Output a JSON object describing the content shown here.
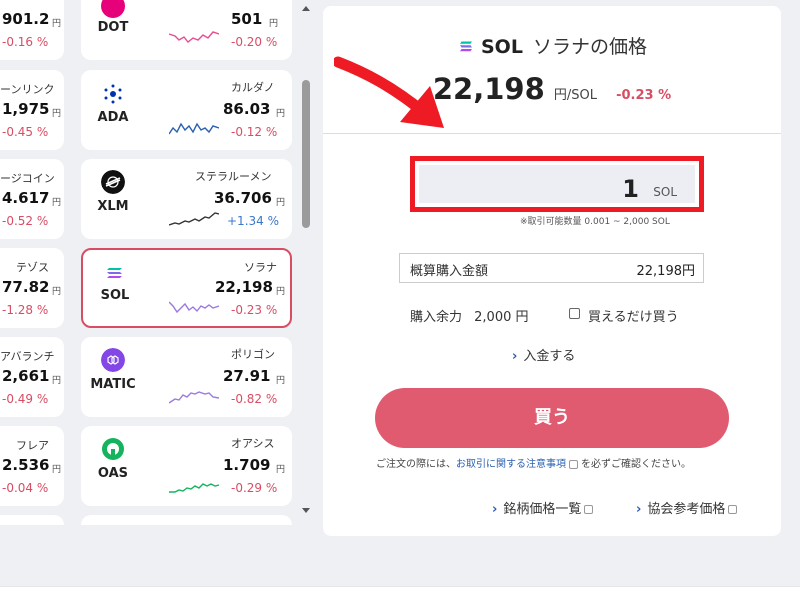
{
  "coins_col1": [
    {
      "ticker": "",
      "name": "",
      "price": "901.2",
      "yen": "円",
      "change": "-0.16 %",
      "dir": "neg"
    },
    {
      "ticker": "",
      "name": "ーンリンク",
      "price": "1,975",
      "yen": "円",
      "change": "-0.45 %",
      "dir": "neg"
    },
    {
      "ticker": "",
      "name": "ージコイン",
      "price": "4.617",
      "yen": "円",
      "change": "-0.52 %",
      "dir": "neg"
    },
    {
      "ticker": "",
      "name": "テゾス",
      "price": "77.82",
      "yen": "円",
      "change": "-1.28 %",
      "dir": "neg"
    },
    {
      "ticker": "",
      "name": "アバランチ",
      "price": "2,661",
      "yen": "円",
      "change": "-0.49 %",
      "dir": "neg"
    },
    {
      "ticker": "",
      "name": "フレア",
      "price": "2.536",
      "yen": "円",
      "change": "-0.04 %",
      "dir": "neg"
    }
  ],
  "coins_col2": [
    {
      "ticker": "DOT",
      "name": "",
      "price": "501",
      "yen": "円",
      "change": "-0.20 %",
      "dir": "neg",
      "icon": "polkadot-icon",
      "color": "#e6007a"
    },
    {
      "ticker": "ADA",
      "name": "カルダノ",
      "price": "86.03",
      "yen": "円",
      "change": "-0.12 %",
      "dir": "neg",
      "icon": "cardano-icon",
      "color": "#0033ad"
    },
    {
      "ticker": "XLM",
      "name": "ステラルーメン",
      "price": "36.706",
      "yen": "円",
      "change": "+1.34 %",
      "dir": "pos",
      "icon": "stellar-icon",
      "color": "#111111"
    },
    {
      "ticker": "SOL",
      "name": "ソラナ",
      "price": "22,198",
      "yen": "円",
      "change": "-0.23 %",
      "dir": "neg",
      "icon": "solana-icon",
      "color": "#9945ff"
    },
    {
      "ticker": "MATIC",
      "name": "ポリゴン",
      "price": "27.91",
      "yen": "円",
      "change": "-0.82 %",
      "dir": "neg",
      "icon": "polygon-icon",
      "color": "#8247e5"
    },
    {
      "ticker": "OAS",
      "name": "オアシス",
      "price": "1.709",
      "yen": "円",
      "change": "-0.29 %",
      "dir": "neg",
      "icon": "oasys-icon",
      "color": "#16b35e"
    }
  ],
  "detail": {
    "symbol": "SOL",
    "title_suffix": "ソラナの価格",
    "price": "22,198",
    "unit": "円/SOL",
    "change": "-0.23 %",
    "quantity": "1",
    "quantity_unit": "SOL",
    "range_note": "※取引可能数量 0.001 ~ 2,000 SOL",
    "estimate_label": "概算購入金額",
    "estimate_value": "22,198円",
    "margin_label": "購入余力",
    "margin_value": "2,000 円",
    "buy_all_label": "買えるだけ買う",
    "deposit_label": "入金する",
    "buy_label": "買う",
    "notice_pre": "ご注文の際には、",
    "notice_link": "お取引に関する注意事項",
    "notice_post": "を必ずご確認ください。",
    "link_list": "銘柄価格一覧",
    "link_ref": "協会参考価格"
  },
  "colors": {
    "accent_red": "#d84d64",
    "button": "#e05a70",
    "highlight": "#ee1b24",
    "positive": "#3a78c9"
  }
}
